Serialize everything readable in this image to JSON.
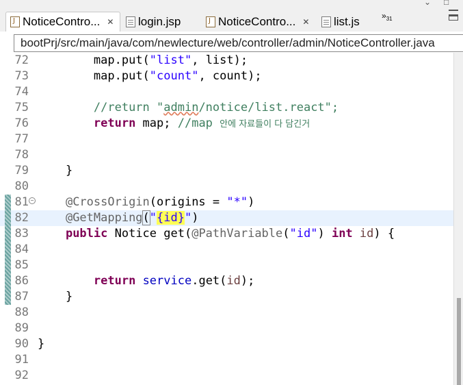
{
  "tabs": [
    {
      "label": "NoticeContro...",
      "icon": "java-file-icon",
      "active": true
    },
    {
      "label": "login.jsp",
      "icon": "file-icon",
      "active": false
    },
    {
      "label": "NoticeContro...",
      "icon": "java-file-icon",
      "active": false
    },
    {
      "label": "list.js",
      "icon": "file-icon",
      "active": false
    }
  ],
  "tab_close_glyph": "✕",
  "overflow": {
    "chevron": "»",
    "count": "31"
  },
  "breadcrumb_path": "bootPrj/src/main/java/com/newlecture/web/controller/admin/NoticeController.java",
  "current_line": "82",
  "line_numbers": [
    "72",
    "73",
    "74",
    "75",
    "76",
    "77",
    "78",
    "79",
    "80",
    "81",
    "82",
    "83",
    "84",
    "85",
    "86",
    "87",
    "88",
    "89",
    "90",
    "91",
    "92"
  ],
  "code": {
    "l72": [
      "map",
      ".put(",
      "\"list\"",
      ", list);"
    ],
    "l73": [
      "map",
      ".put(",
      "\"count\"",
      ", count);"
    ],
    "l75": [
      "//return \"",
      "admin",
      "/notice/list.react\";"
    ],
    "l76": [
      "return",
      " map; ",
      "//map",
      " ",
      "안에 자료들이 다 담긴거"
    ],
    "l79": [
      "}"
    ],
    "l81": [
      "@CrossOrigin",
      "(origins = ",
      "\"*\"",
      ")"
    ],
    "l82": [
      "@GetMapping",
      "(",
      "\"",
      "{id}",
      "\"",
      ")"
    ],
    "l83": [
      "public",
      " Notice get(",
      "@PathVariable",
      "(",
      "\"id\"",
      ") ",
      "int",
      " ",
      "id",
      ") {"
    ],
    "l86": [
      "return",
      " ",
      "service",
      ".get(",
      "id",
      ");"
    ],
    "l87": [
      "}"
    ],
    "l90": [
      "}"
    ]
  },
  "colors": {
    "keyword": "#7f0055",
    "string": "#2a00ff",
    "comment": "#3f7f5f",
    "annotation": "#646464",
    "field": "#0000c0",
    "local_variable": "#6a3e3e",
    "match_highlight": "#ffff55",
    "current_line_bg": "#e8f2fe",
    "change_marker": "#6aa3a0"
  }
}
